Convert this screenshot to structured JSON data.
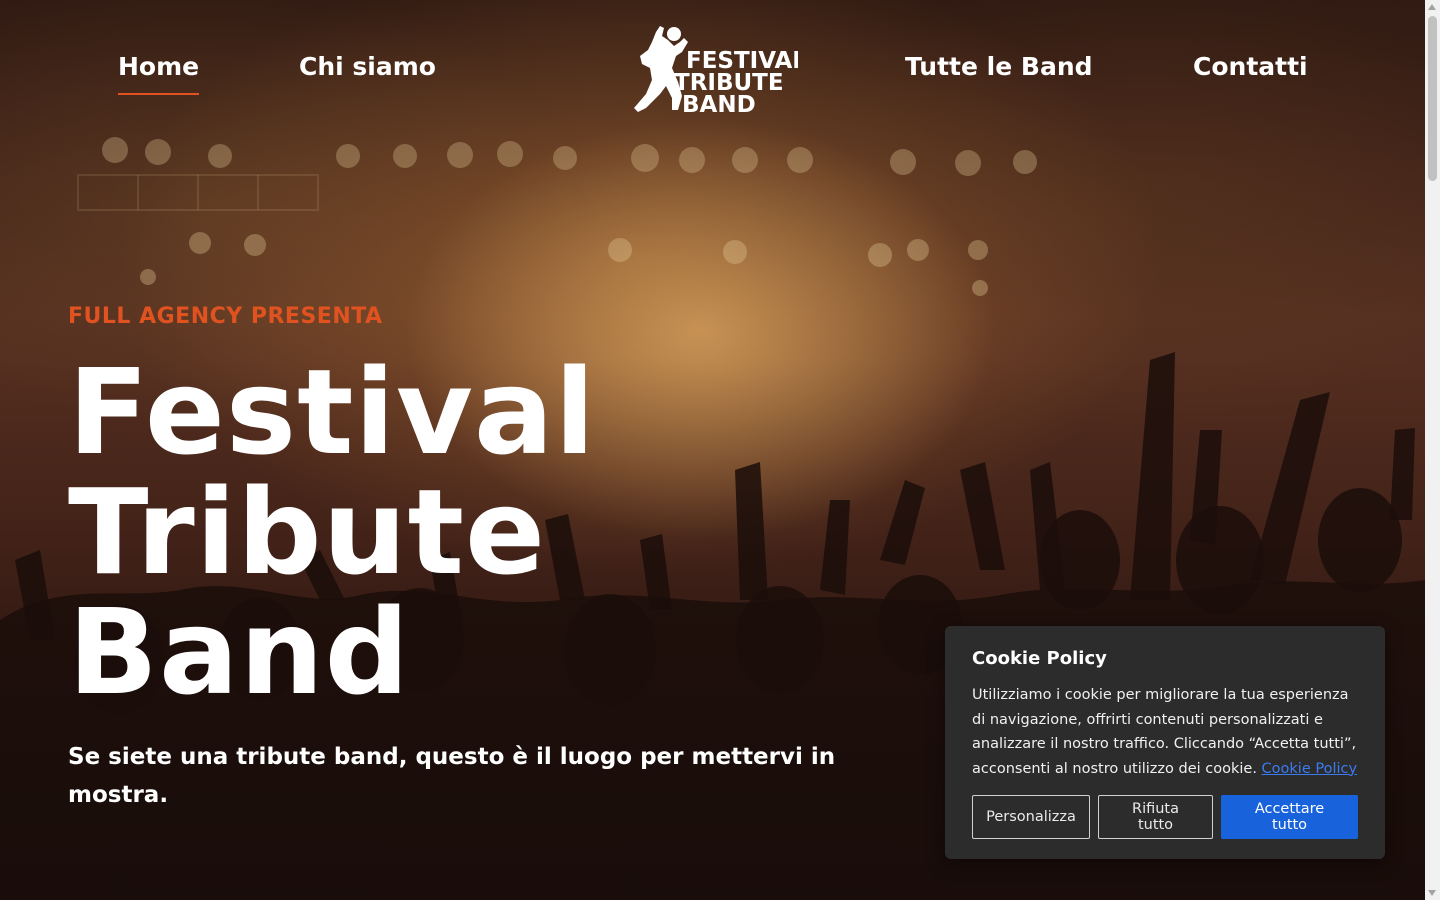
{
  "nav": {
    "items": [
      {
        "label": "Home",
        "active": true
      },
      {
        "label": "Chi siamo",
        "active": false
      },
      {
        "label": "Tutte le Band",
        "active": false
      },
      {
        "label": "Contatti",
        "active": false
      }
    ],
    "logo": {
      "line1": "FESTIVAL",
      "line2": "TRIBUTE",
      "line3": "BAND"
    }
  },
  "hero": {
    "eyebrow": "FULL AGENCY PRESENTA",
    "title_lines": [
      "Festival",
      "Tribute",
      "Band"
    ],
    "subtitle": "Se siete una tribute band, questo è il luogo per mettervi in mostra."
  },
  "cookie": {
    "title": "Cookie Policy",
    "text": "Utilizziamo i cookie per migliorare la tua esperienza di navigazione, offrirti contenuti personalizzati e analizzare il nostro traffico. Cliccando “Accetta tutti”, acconsenti al nostro utilizzo dei cookie.",
    "link": "Cookie Policy",
    "buttons": {
      "customize": "Personalizza",
      "reject": "Rifiuta tutto",
      "accept": "Accettare tutto"
    }
  },
  "colors": {
    "accent": "#e0521f",
    "primary_button": "#1863dc",
    "cookie_bg": "#2c2c2c"
  }
}
